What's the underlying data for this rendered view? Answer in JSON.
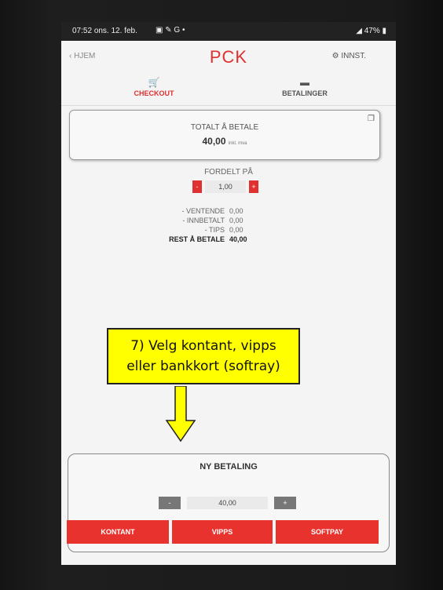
{
  "status_bar": {
    "time": "07:52",
    "date": "ons. 12. feb.",
    "signal_battery": "47%"
  },
  "app_bar": {
    "back_label": "HJEM",
    "logo": "PCK",
    "settings_label": "INNST."
  },
  "tabs": [
    {
      "label": "CHECKOUT",
      "icon": "cart-icon",
      "active": true
    },
    {
      "label": "BETALINGER",
      "icon": "card-icon",
      "active": false
    }
  ],
  "total": {
    "label": "TOTALT Å BETALE",
    "amount": "40,00",
    "suffix": "inkl. mva"
  },
  "split": {
    "label": "FORDELT PÅ",
    "minus": "-",
    "value": "1,00",
    "plus": "+"
  },
  "summary": [
    {
      "label": "- VENTENDE",
      "value": "0,00"
    },
    {
      "label": "- INNBETALT",
      "value": "0,00"
    },
    {
      "label": "- TIPS",
      "value": "0,00"
    },
    {
      "label": "REST Å BETALE",
      "value": "40,00"
    }
  ],
  "callout": {
    "line1": "7) Velg kontant, vipps",
    "line2": "eller bankkort (softray)"
  },
  "payment": {
    "title": "NY BETALING",
    "minus": "-",
    "amount": "40,00",
    "plus": "+",
    "buttons": [
      "KONTANT",
      "VIPPS",
      "SOFTPAY"
    ]
  },
  "colors": {
    "accent": "#e03030",
    "callout": "#ffff00"
  }
}
